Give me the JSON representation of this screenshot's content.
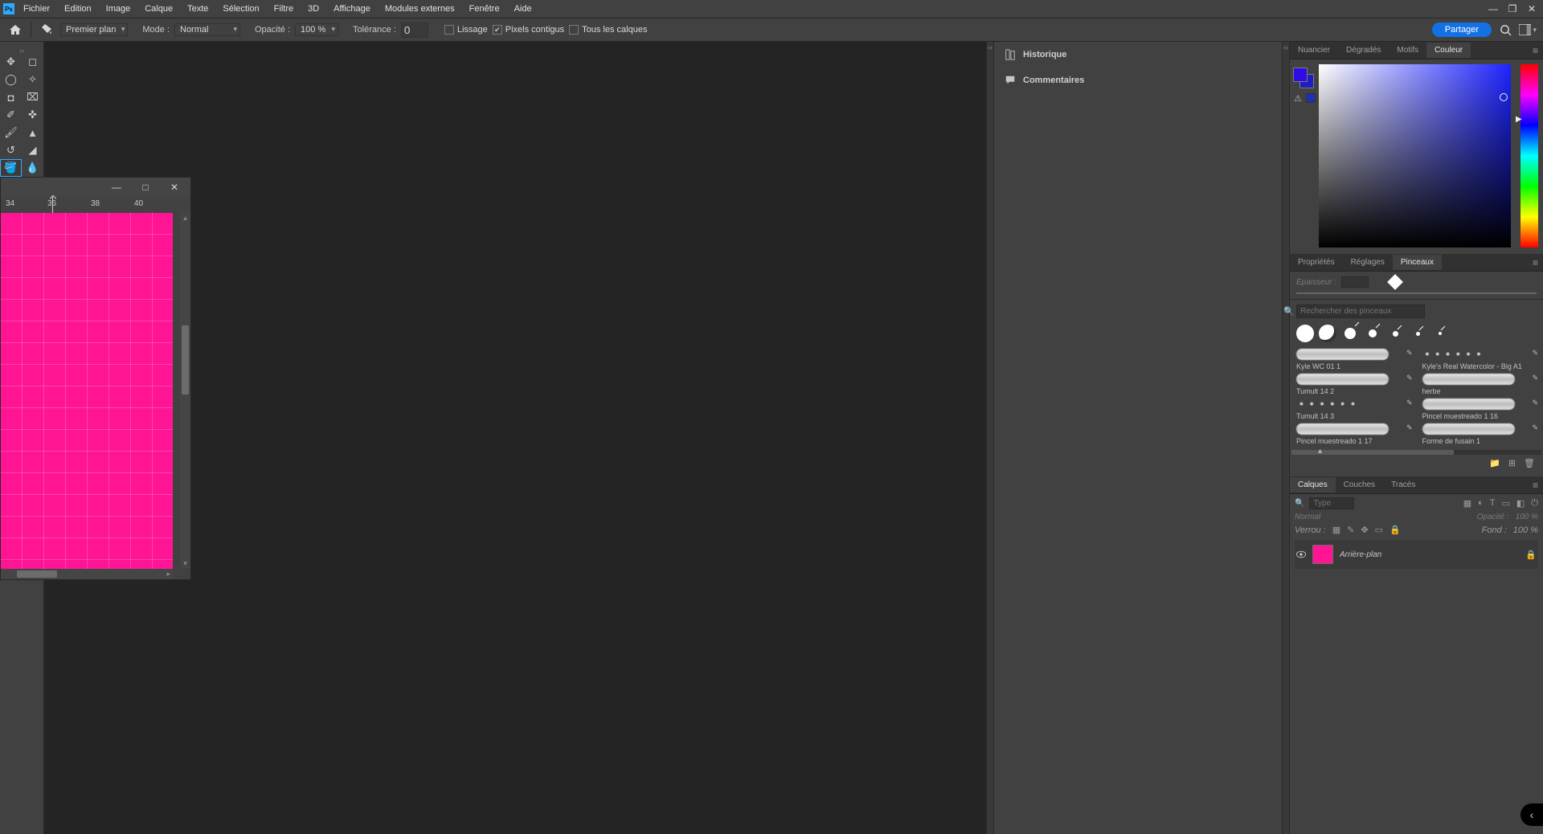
{
  "menu": {
    "items": [
      "Fichier",
      "Edition",
      "Image",
      "Calque",
      "Texte",
      "Sélection",
      "Filtre",
      "3D",
      "Affichage",
      "Modules externes",
      "Fenêtre",
      "Aide"
    ]
  },
  "options": {
    "foreground_mode": "Premier plan",
    "mode_label": "Mode :",
    "mode_value": "Normal",
    "opacity_label": "Opacité :",
    "opacity_value": "100 %",
    "tolerance_label": "Tolérance :",
    "tolerance_value": "0",
    "antialias_label": "Lissage",
    "antialias_checked": false,
    "contiguous_label": "Pixels contigus",
    "contiguous_checked": true,
    "all_layers_label": "Tous les calques",
    "all_layers_checked": false,
    "share_label": "Partager"
  },
  "collapsed_panels": {
    "history": "Historique",
    "comments": "Commentaires"
  },
  "doc": {
    "ruler_marks": [
      "34",
      "36",
      "38",
      "40"
    ],
    "canvas_color": "#ff1493"
  },
  "color_panel": {
    "tabs": [
      "Nuancier",
      "Dégradés",
      "Motifs",
      "Couleur"
    ],
    "active_tab": 3,
    "foreground": "#300be6",
    "background": "#1e1ec1"
  },
  "brush_panel": {
    "tabs": [
      "Propriétés",
      "Réglages",
      "Pinceaux"
    ],
    "active_tab": 2,
    "epaisseur_label": "Epaisseur :",
    "search_placeholder": "Rechercher des pinceaux",
    "brushes": [
      {
        "name": "Kyle WC 01 1",
        "style": "solid"
      },
      {
        "name": "Kyle's Real Watercolor - Big A1",
        "style": "dotted"
      },
      {
        "name": "Tumult 14 2",
        "style": "solid"
      },
      {
        "name": "herbe",
        "style": "solid"
      },
      {
        "name": "Tumult 14 3",
        "style": "dotted"
      },
      {
        "name": "Pincel muestreado 1 16",
        "style": "solid"
      },
      {
        "name": "Pincel muestreado 1 17",
        "style": "solid"
      },
      {
        "name": "Forme de fusain 1",
        "style": "solid"
      }
    ]
  },
  "layers_panel": {
    "tabs": [
      "Calques",
      "Couches",
      "Tracés"
    ],
    "active_tab": 0,
    "type_label": "Type",
    "blend_mode": "Normal",
    "opacity_label": "Opacité :",
    "opacity_value": "100 %",
    "lock_label": "Verrou :",
    "fill_label": "Fond :",
    "fill_value": "100 %",
    "layer_name": "Arrière-plan"
  }
}
